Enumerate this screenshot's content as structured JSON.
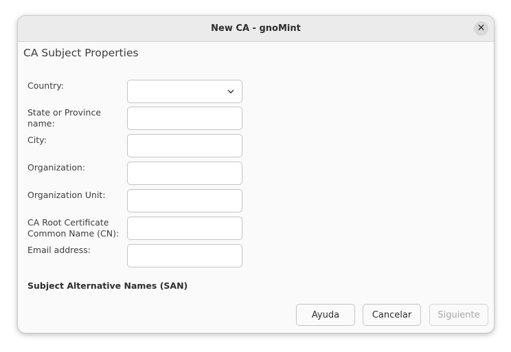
{
  "window": {
    "title": "New CA - gnoMint",
    "close_glyph": "✕"
  },
  "main": {
    "section_title": "CA Subject Properties",
    "fields": {
      "country": {
        "label": "Country:",
        "value": ""
      },
      "state": {
        "label": "State or Province name:",
        "value": ""
      },
      "city": {
        "label": "City:",
        "value": ""
      },
      "organization": {
        "label": "Organization:",
        "value": ""
      },
      "organization_unit": {
        "label": "Organization Unit:",
        "value": ""
      },
      "common_name": {
        "label": "CA Root Certificate Common Name (CN):",
        "value": ""
      },
      "email": {
        "label": "Email address:",
        "value": ""
      }
    },
    "san_label": "Subject Alternative Names (SAN)"
  },
  "buttons": {
    "help": "Ayuda",
    "cancel": "Cancelar",
    "next": "Siguiente"
  },
  "icons": {
    "close": "close-icon",
    "dropdown": "chevron-down-icon"
  },
  "colors": {
    "window_bg": "#fafafa",
    "titlebar_bg": "#ebebeb",
    "text": "#3d3d3d",
    "disabled_text": "#a8a8a8"
  }
}
